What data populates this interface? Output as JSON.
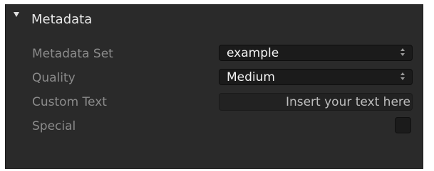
{
  "section": {
    "title": "Metadata",
    "expanded": true,
    "disclosure_icon": "triangle-down-icon"
  },
  "fields": {
    "metadata_set": {
      "label": "Metadata Set",
      "selected": "example"
    },
    "quality": {
      "label": "Quality",
      "selected": "Medium"
    },
    "custom_text": {
      "label": "Custom Text",
      "value": "",
      "placeholder": "Insert your text here"
    },
    "special": {
      "label": "Special",
      "checked": false
    }
  },
  "colors": {
    "panel_bg": "#2a2a2a",
    "label_text": "#8b8b8b",
    "title_text": "#e8e8e8",
    "control_bg": "#1b1b1b",
    "value_text": "#f2f2f2"
  }
}
